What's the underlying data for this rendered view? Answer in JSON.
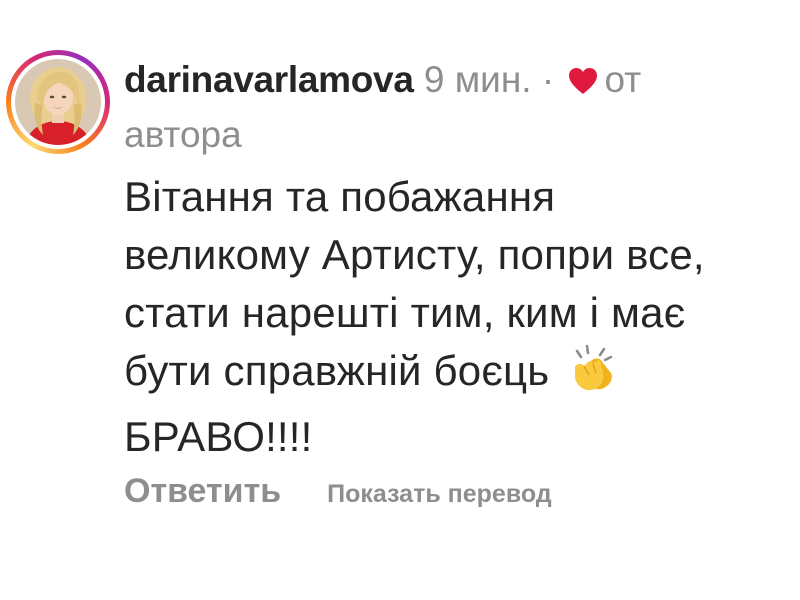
{
  "comment": {
    "username": "darinavarlamova",
    "time": "9 мин.",
    "separator": "·",
    "liked_by_author_prefix": "от",
    "liked_by_author_suffix": "автора",
    "liked_icon": "heart-icon",
    "text": "Вітання та побажання\nвеликому Артисту, попри все,\nстати нарешті тим, ким і має\nбути справжній боєць",
    "emoji": "clapping-hands-icon",
    "text_end": "БРАВО!!!!",
    "reply_label": "Ответить",
    "translate_label": "Показать перевод"
  },
  "colors": {
    "text": "#262626",
    "muted": "#8e8e8e",
    "heart": "#e0193f"
  }
}
